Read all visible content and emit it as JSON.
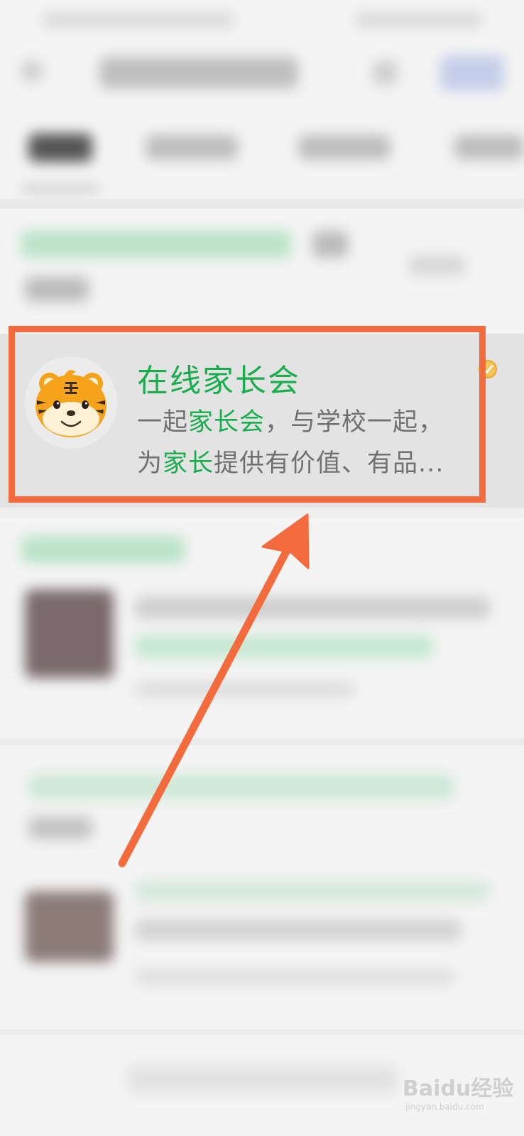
{
  "card": {
    "title": "在线家长会",
    "desc_line1": {
      "a": "一起",
      "b": "家长会",
      "c": "，与学校一起，"
    },
    "desc_line2": {
      "a": "为",
      "b": "家长",
      "c": "提供有价值、有品..."
    }
  },
  "watermark": {
    "brand": "Baidu经验",
    "site": "jingyan.baidu.com"
  },
  "colors": {
    "accent_green": "#1aad4e",
    "highlight_orange": "#f36b3d"
  }
}
